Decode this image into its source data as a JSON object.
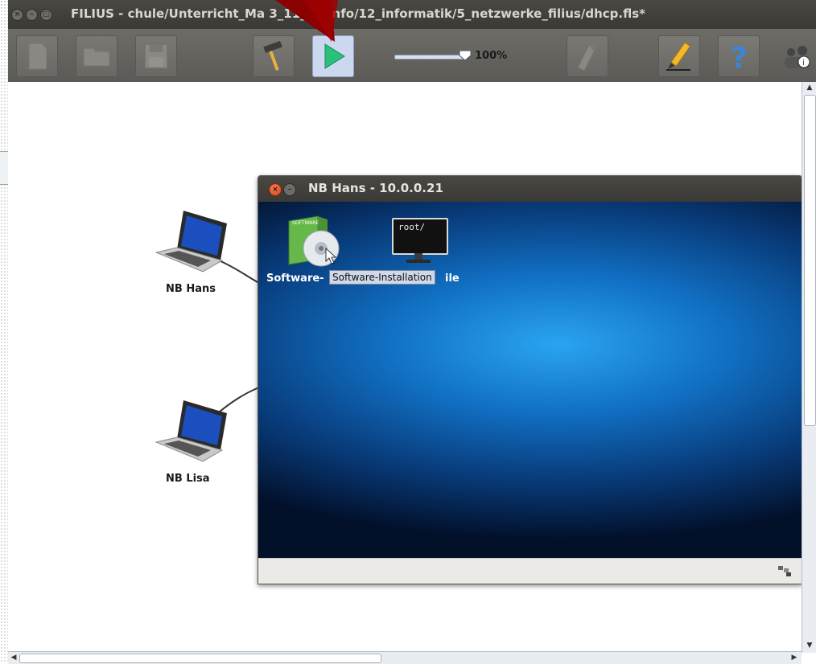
{
  "window": {
    "title": "FILIUS - chule/Unterricht_Ma     3_11_12/Info/12_informatik/5_netzwerke_filius/dhcp.fls*"
  },
  "toolbar": {
    "zoom_value": "100%",
    "zoom_level": 1.0,
    "buttons": [
      {
        "name": "new-file",
        "icon": "document-icon",
        "enabled": false
      },
      {
        "name": "open-file",
        "icon": "folder-icon",
        "enabled": false
      },
      {
        "name": "save-file",
        "icon": "floppy-icon",
        "enabled": false
      },
      {
        "name": "design-mode",
        "icon": "hammer-icon",
        "enabled": true
      },
      {
        "name": "simulation-mode",
        "icon": "play-icon",
        "enabled": true,
        "active": true
      },
      {
        "name": "network-tool",
        "icon": "cable-tool-icon",
        "enabled": false
      },
      {
        "name": "edit-mode",
        "icon": "pencil-icon",
        "enabled": true
      },
      {
        "name": "help",
        "icon": "question-icon",
        "enabled": true
      },
      {
        "name": "info",
        "icon": "info-people-icon",
        "enabled": true
      }
    ]
  },
  "canvas": {
    "nodes": [
      {
        "label": "NB Hans",
        "icon": "laptop-icon"
      },
      {
        "label": "NB Lisa",
        "icon": "laptop-icon"
      }
    ]
  },
  "inner_window": {
    "title": "NB Hans - 10.0.0.21",
    "desktop_icons": [
      {
        "label": "Software-",
        "icon": "software-cd-icon"
      },
      {
        "label": "ile",
        "icon": "terminal-icon",
        "screen_text": "root/"
      }
    ],
    "tooltip": "Software-Installation"
  },
  "colors": {
    "titlebar": "#3f3e3a",
    "toolbar": "#65635f",
    "desktop_blue": "#1170c4",
    "arrow_red": "#8b0000",
    "active_button": "#ccd8f0"
  }
}
